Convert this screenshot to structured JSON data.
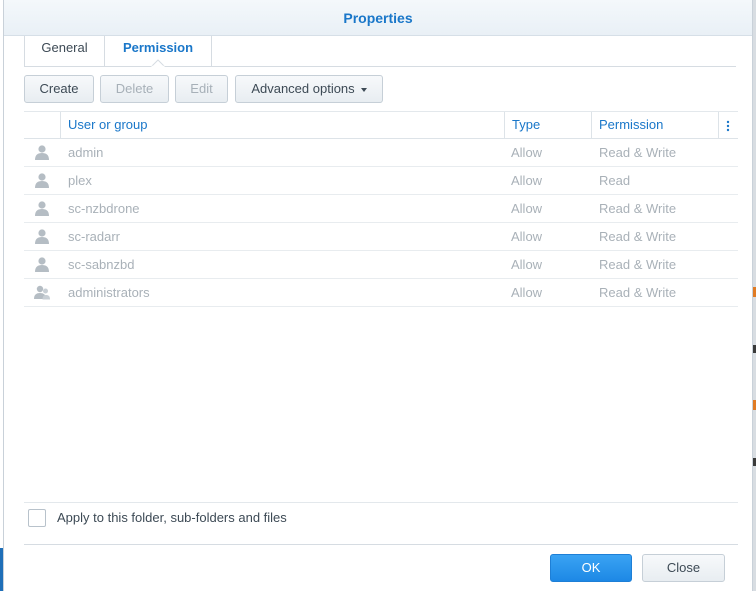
{
  "window": {
    "title": "Properties"
  },
  "tabs": [
    {
      "label": "General",
      "active": false
    },
    {
      "label": "Permission",
      "active": true
    }
  ],
  "toolbar": {
    "create_label": "Create",
    "delete_label": "Delete",
    "edit_label": "Edit",
    "advanced_label": "Advanced options"
  },
  "grid": {
    "columns": [
      "User or group",
      "Type",
      "Permission"
    ],
    "rows": [
      {
        "icon": "user-icon",
        "name": "admin",
        "type": "Allow",
        "permission": "Read & Write"
      },
      {
        "icon": "user-icon",
        "name": "plex",
        "type": "Allow",
        "permission": "Read"
      },
      {
        "icon": "user-icon",
        "name": "sc-nzbdrone",
        "type": "Allow",
        "permission": "Read & Write"
      },
      {
        "icon": "user-icon",
        "name": "sc-radarr",
        "type": "Allow",
        "permission": "Read & Write"
      },
      {
        "icon": "user-icon",
        "name": "sc-sabnzbd",
        "type": "Allow",
        "permission": "Read & Write"
      },
      {
        "icon": "group-icon",
        "name": "administrators",
        "type": "Allow",
        "permission": "Read & Write"
      }
    ]
  },
  "apply": {
    "label": "Apply to this folder, sub-folders and files",
    "checked": false
  },
  "buttons": {
    "ok_label": "OK",
    "close_label": "Close"
  },
  "colors": {
    "accent": "#1a77c9",
    "primary_button": "#2596ec",
    "disabled_text": "#a9b1b8"
  }
}
